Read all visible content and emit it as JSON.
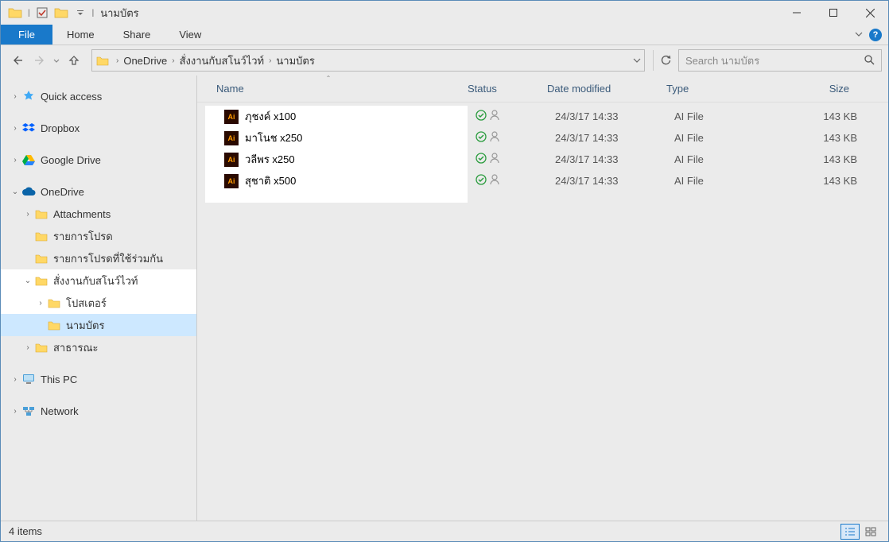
{
  "title": "นามบัตร",
  "ribbon": {
    "file": "File",
    "tabs": [
      "Home",
      "Share",
      "View"
    ]
  },
  "breadcrumbs": [
    "OneDrive",
    "สั่งงานกับสโนว์ไวท์",
    "นามบัตร"
  ],
  "search": {
    "placeholder": "Search นามบัตร"
  },
  "sidebar": {
    "quick": "Quick access",
    "dropbox": "Dropbox",
    "gdrive": "Google Drive",
    "onedrive": "OneDrive",
    "onedrive_items": [
      "Attachments",
      "รายการโปรด",
      "รายการโปรดที่ใช้ร่วมกัน",
      "สั่งงานกับสโนว์ไวท์"
    ],
    "sub_items": [
      "โปสเตอร์",
      "นามบัตร"
    ],
    "public": "สาธารณะ",
    "thispc": "This PC",
    "network": "Network"
  },
  "columns": {
    "name": "Name",
    "status": "Status",
    "modified": "Date modified",
    "type": "Type",
    "size": "Size"
  },
  "files": [
    {
      "name": "ภุชงค์ x100",
      "modified": "24/3/17 14:33",
      "type": "AI File",
      "size": "143 KB"
    },
    {
      "name": "มาโนช x250",
      "modified": "24/3/17 14:33",
      "type": "AI File",
      "size": "143 KB"
    },
    {
      "name": "วลีพร x250",
      "modified": "24/3/17 14:33",
      "type": "AI File",
      "size": "143 KB"
    },
    {
      "name": "สุชาติ x500",
      "modified": "24/3/17 14:33",
      "type": "AI File",
      "size": "143 KB"
    }
  ],
  "status": "4 items"
}
